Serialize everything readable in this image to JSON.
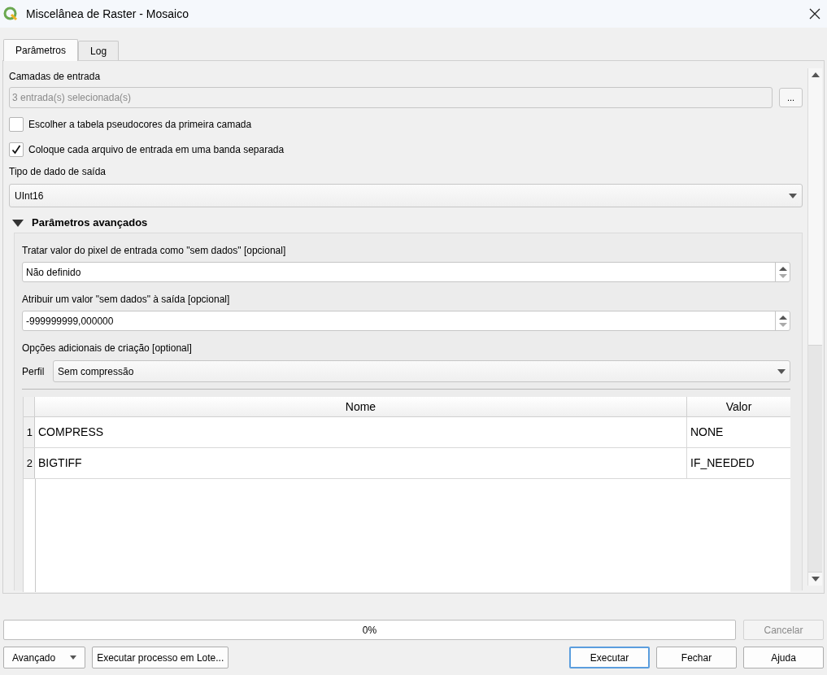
{
  "window": {
    "title": "Miscelânea de Raster  - Mosaico"
  },
  "tabs": [
    {
      "label": "Parâmetros",
      "selected": true
    },
    {
      "label": "Log",
      "selected": false
    }
  ],
  "input_layers": {
    "label": "Camadas de entrada",
    "value": "3 entrada(s) selecionada(s)",
    "disabled": true,
    "button": "..."
  },
  "checkboxes": [
    {
      "label": "Escolher a tabela pseudocores da primeira camada",
      "checked": false
    },
    {
      "label": "Coloque cada arquivo de entrada em uma banda separada",
      "checked": true
    }
  ],
  "output_type": {
    "label": "Tipo de dado de saída",
    "value": "UInt16"
  },
  "advanced": {
    "label": "Parâmetros avançados",
    "expanded": true,
    "nodata_in": {
      "label": "Tratar valor do pixel de entrada como \"sem dados\" [opcional]",
      "value": "Não definido"
    },
    "nodata_out": {
      "label": "Atribuir um valor \"sem dados\" à saída [opcional]",
      "value": "-999999999,000000"
    },
    "creation_options": {
      "label": "Opções adicionais de criação [optional]",
      "profile_label": "Perfil",
      "profile_value": "Sem compressão",
      "columns": [
        "Nome",
        "Valor"
      ],
      "rows": [
        {
          "index": "1",
          "name": "COMPRESS",
          "value": "NONE"
        },
        {
          "index": "2",
          "name": "BIGTIFF",
          "value": "IF_NEEDED"
        }
      ]
    }
  },
  "progress": {
    "text": "0%",
    "level": 0,
    "cancel": {
      "label": "Cancelar",
      "disabled": true
    }
  },
  "buttons_left": [
    {
      "label": "Avançado",
      "kind": "menu"
    },
    {
      "label": "Executar processo em Lote...",
      "kind": "plain"
    }
  ],
  "buttons_right": [
    {
      "label": "Executar",
      "kind": "default"
    },
    {
      "label": "Fechar",
      "kind": "plain"
    },
    {
      "label": "Ajuda",
      "kind": "plain"
    }
  ]
}
